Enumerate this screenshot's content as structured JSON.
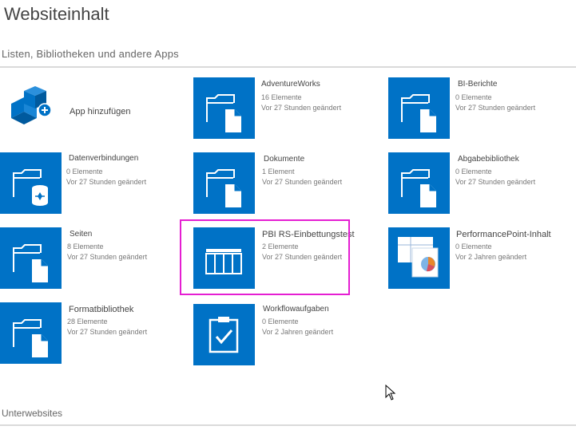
{
  "page": {
    "title": "Websiteinhalt",
    "section_heading": "Listen, Bibliotheken und andere Apps",
    "subsites_heading": "Unterwebsites"
  },
  "colors": {
    "tile": "#0072c6",
    "highlight": "#e51ed2"
  },
  "add_app": {
    "label": "App hinzufügen",
    "icon": "add-app-icon"
  },
  "items": [
    {
      "title": "AdventureWorks",
      "count": "16 Elemente",
      "modified": "Vor 27 Stunden geändert",
      "icon": "document-library-icon"
    },
    {
      "title": "BI-Berichte",
      "count": "0 Elemente",
      "modified": "Vor 27 Stunden geändert",
      "icon": "document-library-icon"
    },
    {
      "title": "Datenverbindungen",
      "count": "0 Elemente",
      "modified": "Vor 27 Stunden geändert",
      "icon": "data-connection-library-icon"
    },
    {
      "title": "Dokumente",
      "count": "1 Element",
      "modified": "Vor 27 Stunden geändert",
      "icon": "document-library-icon"
    },
    {
      "title": "Abgabebibliothek",
      "count": "0 Elemente",
      "modified": "Vor 27 Stunden geändert",
      "icon": "document-library-icon"
    },
    {
      "title": "Seiten",
      "count": "8 Elemente",
      "modified": "Vor 27 Stunden geändert",
      "icon": "document-library-icon"
    },
    {
      "title": "PBI RS-Einbettungstest",
      "count": "2 Elemente",
      "modified": "Vor 27 Stunden geändert",
      "icon": "custom-list-icon"
    },
    {
      "title": "PerformancePoint-Inhalt",
      "count": "0 Elemente",
      "modified": "Vor 2 Jahren geändert",
      "icon": "performancepoint-content-icon"
    },
    {
      "title": "Formatbibliothek",
      "count": "28 Elemente",
      "modified": "Vor 27 Stunden geändert",
      "icon": "document-library-icon"
    },
    {
      "title": "Workflowaufgaben",
      "count": "0 Elemente",
      "modified": "Vor 2 Jahren geändert",
      "icon": "task-list-icon"
    }
  ]
}
